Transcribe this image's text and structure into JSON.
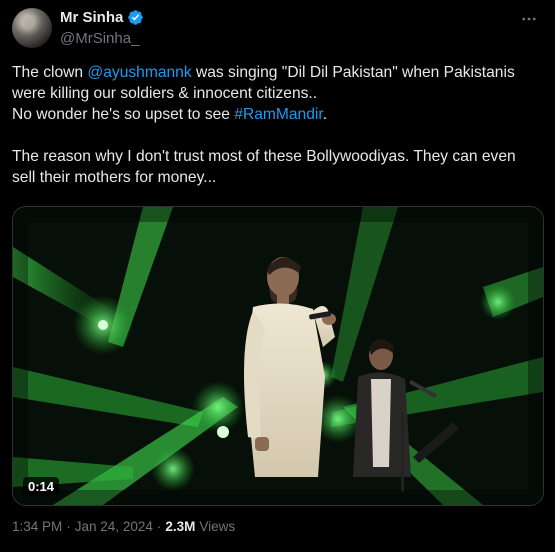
{
  "author": {
    "name": "Mr Sinha",
    "handle": "@MrSinha_"
  },
  "tweet": {
    "line1_before": "The clown ",
    "mention": "@ayushmannk",
    "line1_after": " was singing \"Dil Dil Pakistan\" when Pakistanis were killing our soldiers & innocent citizens..",
    "line2_before": "No wonder he's so upset to see ",
    "hashtag": "#RamMandir",
    "line2_after": ".",
    "paragraph2": "The reason why I don't trust most of these Bollywoodiyas. They can even sell their mothers for money..."
  },
  "video": {
    "duration": "0:14"
  },
  "meta": {
    "time": "1:34 PM",
    "separator": "·",
    "date": "Jan 24, 2024",
    "views_count": "2.3M",
    "views_label": "Views"
  },
  "colors": {
    "link": "#1d9bf0",
    "verified": "#1d9bf0",
    "stage_light": "#38e84a"
  },
  "icons": {
    "verified": "verified-badge-icon",
    "more": "more-dots-icon"
  }
}
